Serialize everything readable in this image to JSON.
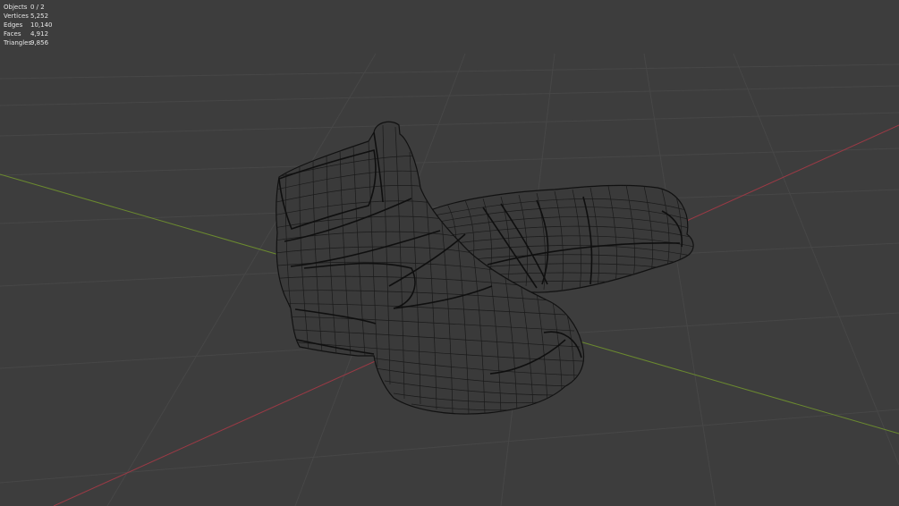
{
  "viewport": {
    "background_color": "#3d3d3d",
    "grid_color": "#474747",
    "x_axis_color": "#9b3a45",
    "y_axis_color": "#6b8a2f",
    "mesh_fill_color": "#3a3a3a",
    "mesh_wire_color": "#1a1a1a",
    "display_mode": "wireframe",
    "objects_depicted": [
      "shoe",
      "shoe"
    ]
  },
  "stats": [
    {
      "label": "Objects",
      "value": "0 / 2"
    },
    {
      "label": "Vertices",
      "value": "5,252"
    },
    {
      "label": "Edges",
      "value": "10,140"
    },
    {
      "label": "Faces",
      "value": "4,912"
    },
    {
      "label": "Triangles",
      "value": "9,856"
    }
  ]
}
